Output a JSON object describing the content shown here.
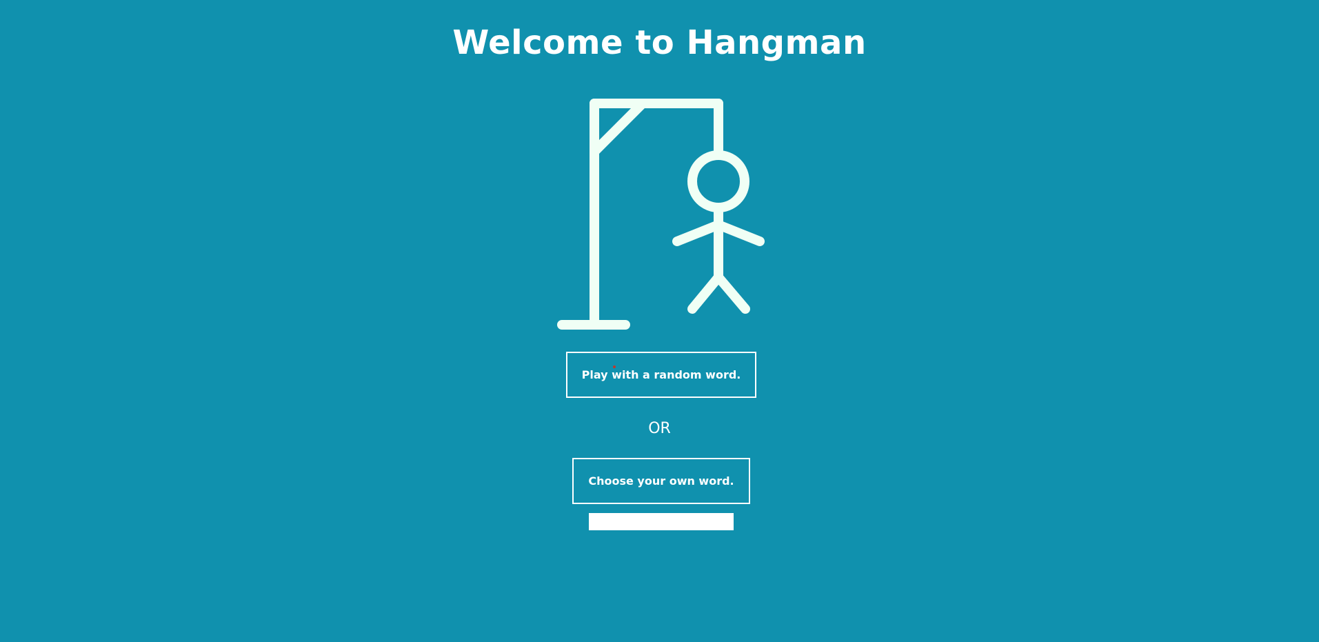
{
  "header": {
    "title": "Welcome to Hangman"
  },
  "actions": {
    "random_label": "Play with a random word.",
    "or_label": "OR",
    "choose_label": "Choose your own word.",
    "word_input_value": "",
    "word_input_placeholder": ""
  },
  "illustration": {
    "icon": "hangman-figure-icon",
    "stroke_color": "#f0fff5"
  },
  "theme": {
    "background": "#1091ae",
    "text": "#ffffff"
  }
}
